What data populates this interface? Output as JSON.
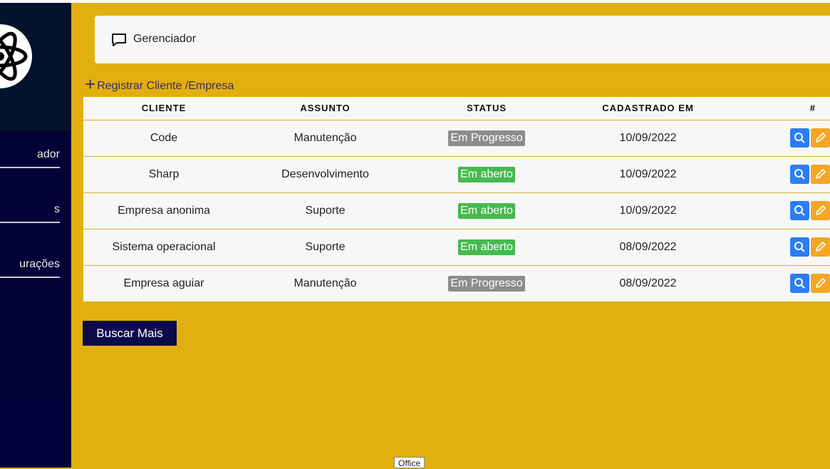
{
  "sidebar": {
    "logo_icon": "atom-icon",
    "items": [
      {
        "label": "ador"
      },
      {
        "label": "s"
      },
      {
        "label": "urações"
      }
    ]
  },
  "header": {
    "icon": "chat-bubble-icon",
    "title": "Gerenciador"
  },
  "register": {
    "icon": "plus-icon",
    "label": "Registrar Cliente /Empresa"
  },
  "table": {
    "columns": [
      "CLIENTE",
      "ASSUNTO",
      "STATUS",
      "CADASTRADO EM",
      "#"
    ],
    "rows": [
      {
        "cliente": "Code",
        "assunto": "Manutenção",
        "status": "Em Progresso",
        "status_type": "progress",
        "data": "10/09/2022"
      },
      {
        "cliente": "Sharp",
        "assunto": "Desenvolvimento",
        "status": "Em aberto",
        "status_type": "open",
        "data": "10/09/2022"
      },
      {
        "cliente": "Empresa anonima",
        "assunto": "Suporte",
        "status": "Em aberto",
        "status_type": "open",
        "data": "10/09/2022"
      },
      {
        "cliente": "Sistema operacional",
        "assunto": "Suporte",
        "status": "Em aberto",
        "status_type": "open",
        "data": "08/09/2022"
      },
      {
        "cliente": "Empresa aguiar",
        "assunto": "Manutenção",
        "status": "Em Progresso",
        "status_type": "progress",
        "data": "08/09/2022"
      }
    ]
  },
  "buscar_label": "Buscar Mais",
  "tooltip": "Office",
  "colors": {
    "background": "#e1b00e",
    "sidebar": "#02023a",
    "badge_progress": "#8c8c8c",
    "badge_open": "#46b94e",
    "search_button": "#2c7df2",
    "edit_button": "#f5a623"
  }
}
